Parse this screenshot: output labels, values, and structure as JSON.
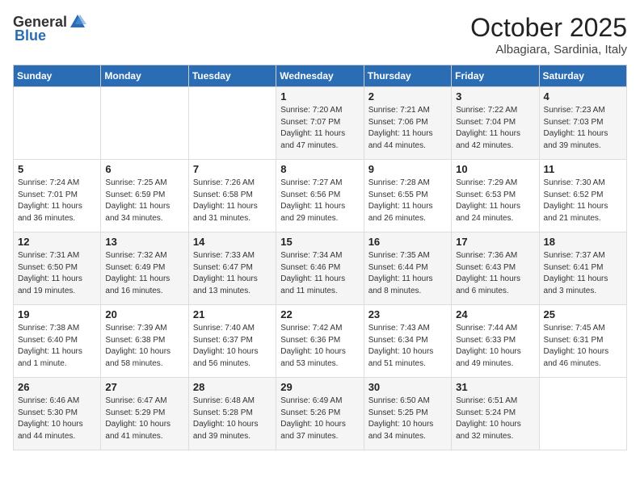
{
  "logo": {
    "general": "General",
    "blue": "Blue"
  },
  "title": {
    "month_year": "October 2025",
    "location": "Albagiara, Sardinia, Italy"
  },
  "days_of_week": [
    "Sunday",
    "Monday",
    "Tuesday",
    "Wednesday",
    "Thursday",
    "Friday",
    "Saturday"
  ],
  "weeks": [
    [
      {
        "day": "",
        "info": ""
      },
      {
        "day": "",
        "info": ""
      },
      {
        "day": "",
        "info": ""
      },
      {
        "day": "1",
        "info": "Sunrise: 7:20 AM\nSunset: 7:07 PM\nDaylight: 11 hours\nand 47 minutes."
      },
      {
        "day": "2",
        "info": "Sunrise: 7:21 AM\nSunset: 7:06 PM\nDaylight: 11 hours\nand 44 minutes."
      },
      {
        "day": "3",
        "info": "Sunrise: 7:22 AM\nSunset: 7:04 PM\nDaylight: 11 hours\nand 42 minutes."
      },
      {
        "day": "4",
        "info": "Sunrise: 7:23 AM\nSunset: 7:03 PM\nDaylight: 11 hours\nand 39 minutes."
      }
    ],
    [
      {
        "day": "5",
        "info": "Sunrise: 7:24 AM\nSunset: 7:01 PM\nDaylight: 11 hours\nand 36 minutes."
      },
      {
        "day": "6",
        "info": "Sunrise: 7:25 AM\nSunset: 6:59 PM\nDaylight: 11 hours\nand 34 minutes."
      },
      {
        "day": "7",
        "info": "Sunrise: 7:26 AM\nSunset: 6:58 PM\nDaylight: 11 hours\nand 31 minutes."
      },
      {
        "day": "8",
        "info": "Sunrise: 7:27 AM\nSunset: 6:56 PM\nDaylight: 11 hours\nand 29 minutes."
      },
      {
        "day": "9",
        "info": "Sunrise: 7:28 AM\nSunset: 6:55 PM\nDaylight: 11 hours\nand 26 minutes."
      },
      {
        "day": "10",
        "info": "Sunrise: 7:29 AM\nSunset: 6:53 PM\nDaylight: 11 hours\nand 24 minutes."
      },
      {
        "day": "11",
        "info": "Sunrise: 7:30 AM\nSunset: 6:52 PM\nDaylight: 11 hours\nand 21 minutes."
      }
    ],
    [
      {
        "day": "12",
        "info": "Sunrise: 7:31 AM\nSunset: 6:50 PM\nDaylight: 11 hours\nand 19 minutes."
      },
      {
        "day": "13",
        "info": "Sunrise: 7:32 AM\nSunset: 6:49 PM\nDaylight: 11 hours\nand 16 minutes."
      },
      {
        "day": "14",
        "info": "Sunrise: 7:33 AM\nSunset: 6:47 PM\nDaylight: 11 hours\nand 13 minutes."
      },
      {
        "day": "15",
        "info": "Sunrise: 7:34 AM\nSunset: 6:46 PM\nDaylight: 11 hours\nand 11 minutes."
      },
      {
        "day": "16",
        "info": "Sunrise: 7:35 AM\nSunset: 6:44 PM\nDaylight: 11 hours\nand 8 minutes."
      },
      {
        "day": "17",
        "info": "Sunrise: 7:36 AM\nSunset: 6:43 PM\nDaylight: 11 hours\nand 6 minutes."
      },
      {
        "day": "18",
        "info": "Sunrise: 7:37 AM\nSunset: 6:41 PM\nDaylight: 11 hours\nand 3 minutes."
      }
    ],
    [
      {
        "day": "19",
        "info": "Sunrise: 7:38 AM\nSunset: 6:40 PM\nDaylight: 11 hours\nand 1 minute."
      },
      {
        "day": "20",
        "info": "Sunrise: 7:39 AM\nSunset: 6:38 PM\nDaylight: 10 hours\nand 58 minutes."
      },
      {
        "day": "21",
        "info": "Sunrise: 7:40 AM\nSunset: 6:37 PM\nDaylight: 10 hours\nand 56 minutes."
      },
      {
        "day": "22",
        "info": "Sunrise: 7:42 AM\nSunset: 6:36 PM\nDaylight: 10 hours\nand 53 minutes."
      },
      {
        "day": "23",
        "info": "Sunrise: 7:43 AM\nSunset: 6:34 PM\nDaylight: 10 hours\nand 51 minutes."
      },
      {
        "day": "24",
        "info": "Sunrise: 7:44 AM\nSunset: 6:33 PM\nDaylight: 10 hours\nand 49 minutes."
      },
      {
        "day": "25",
        "info": "Sunrise: 7:45 AM\nSunset: 6:31 PM\nDaylight: 10 hours\nand 46 minutes."
      }
    ],
    [
      {
        "day": "26",
        "info": "Sunrise: 6:46 AM\nSunset: 5:30 PM\nDaylight: 10 hours\nand 44 minutes."
      },
      {
        "day": "27",
        "info": "Sunrise: 6:47 AM\nSunset: 5:29 PM\nDaylight: 10 hours\nand 41 minutes."
      },
      {
        "day": "28",
        "info": "Sunrise: 6:48 AM\nSunset: 5:28 PM\nDaylight: 10 hours\nand 39 minutes."
      },
      {
        "day": "29",
        "info": "Sunrise: 6:49 AM\nSunset: 5:26 PM\nDaylight: 10 hours\nand 37 minutes."
      },
      {
        "day": "30",
        "info": "Sunrise: 6:50 AM\nSunset: 5:25 PM\nDaylight: 10 hours\nand 34 minutes."
      },
      {
        "day": "31",
        "info": "Sunrise: 6:51 AM\nSunset: 5:24 PM\nDaylight: 10 hours\nand 32 minutes."
      },
      {
        "day": "",
        "info": ""
      }
    ]
  ]
}
